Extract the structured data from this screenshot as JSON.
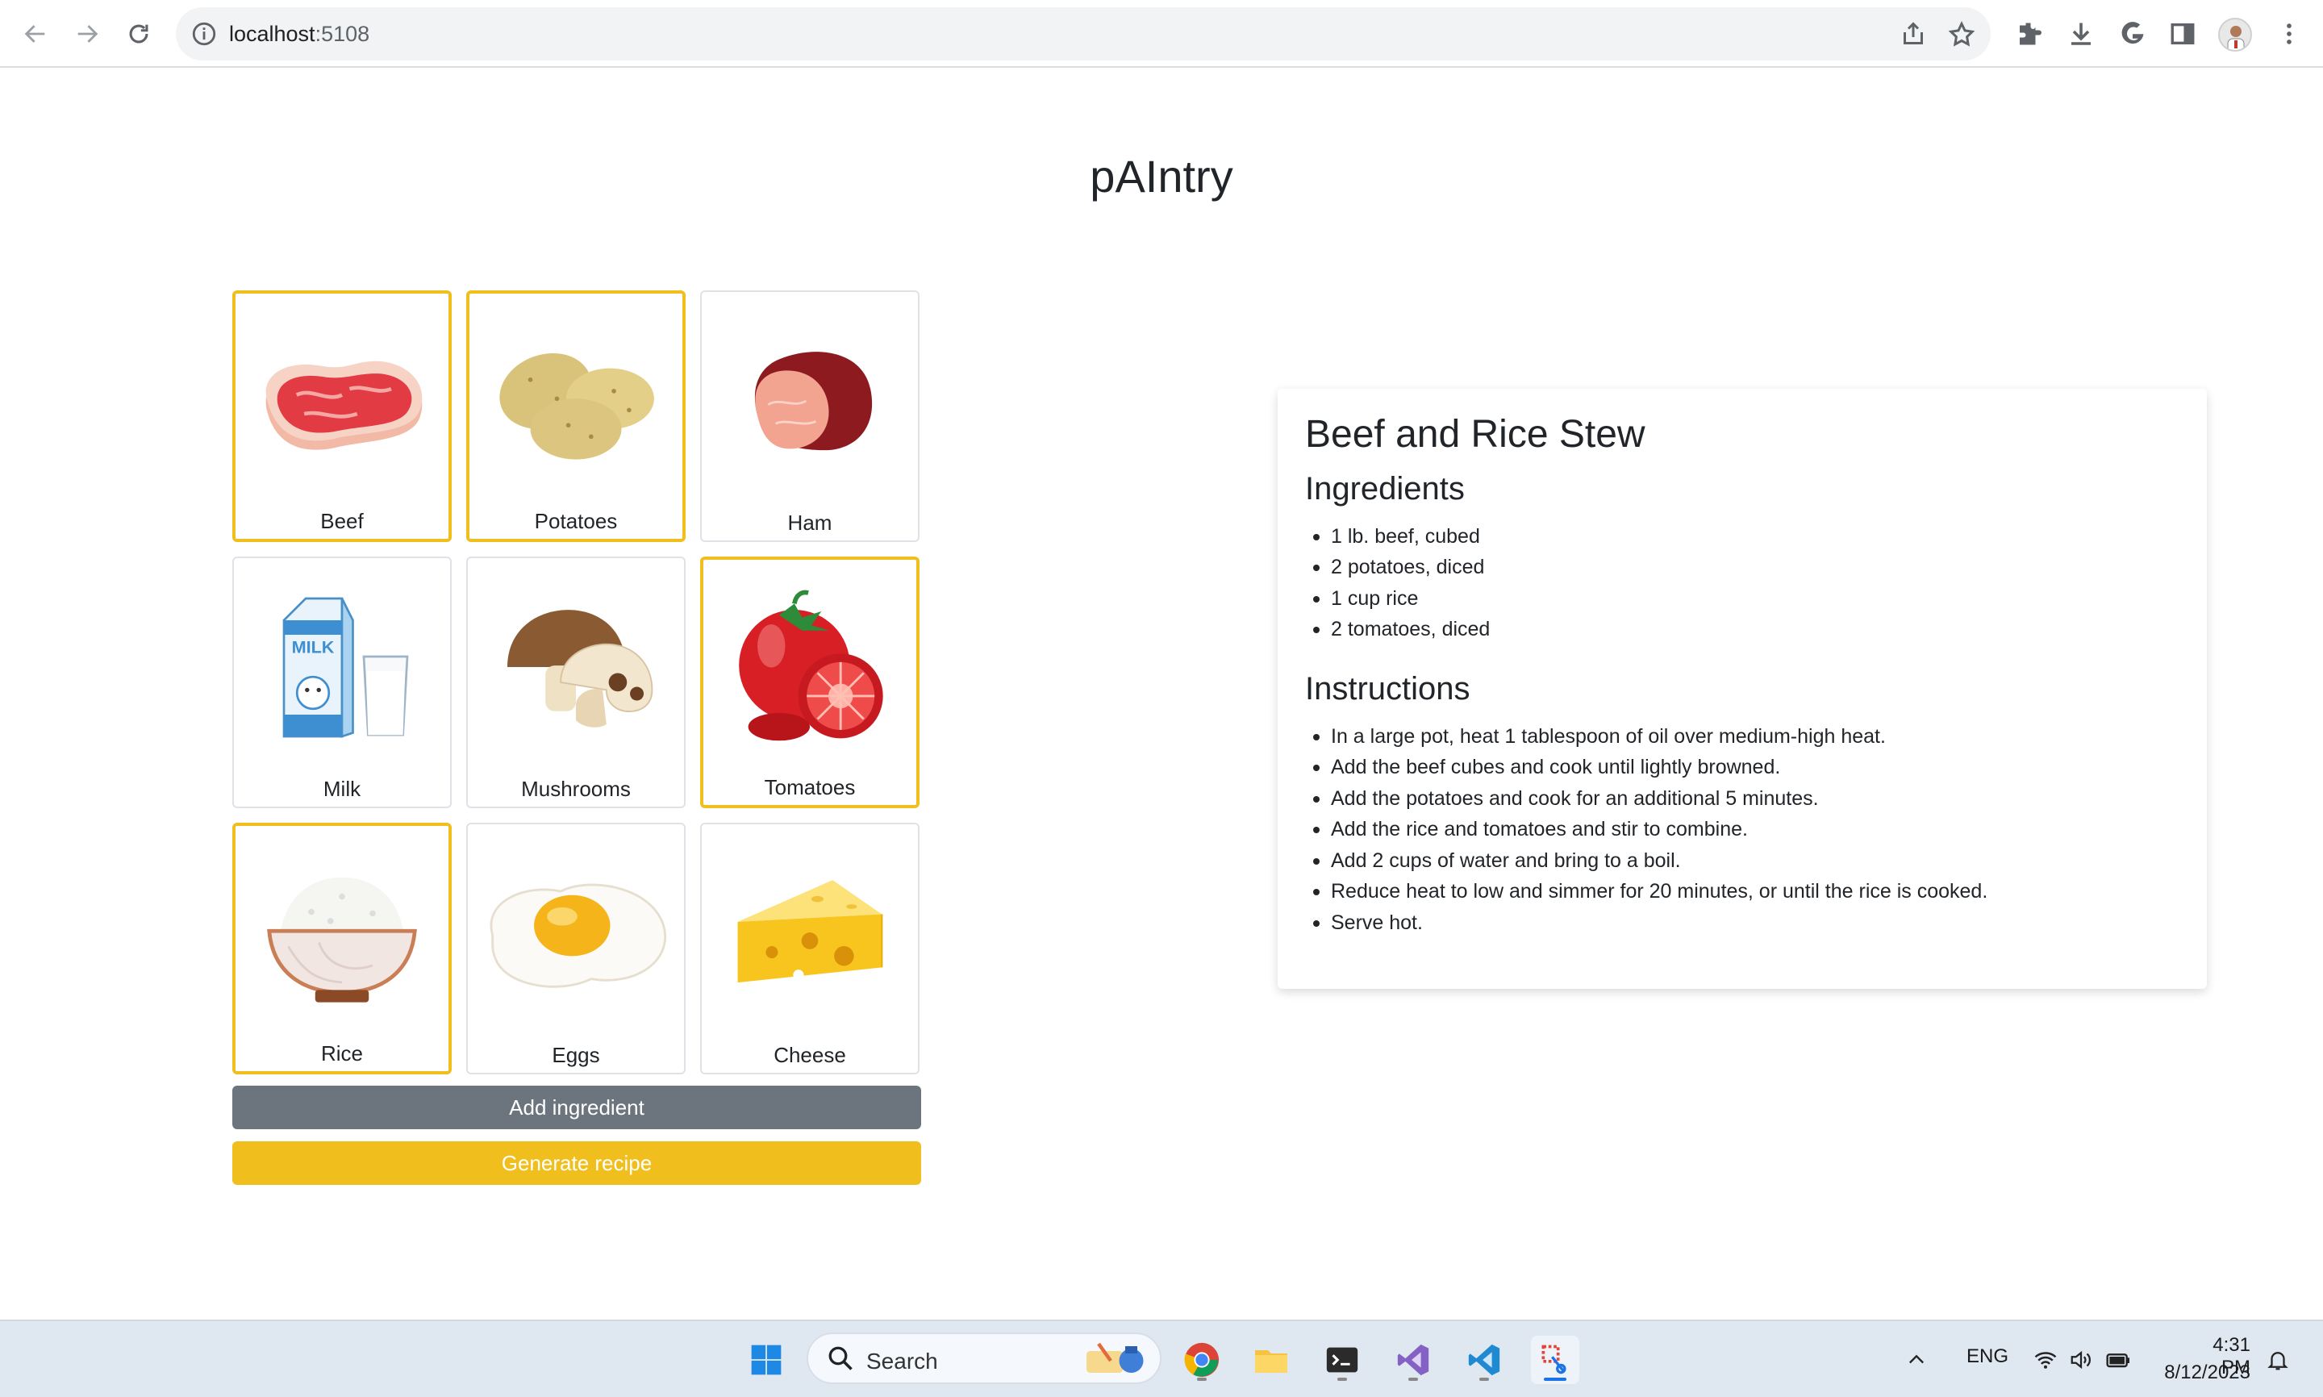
{
  "browser": {
    "url_host": "localhost",
    "url_port": ":5108"
  },
  "page": {
    "title": "pAIntry"
  },
  "ingredients": [
    {
      "name": "Beef",
      "icon": "beef-steak-icon",
      "selected": true
    },
    {
      "name": "Potatoes",
      "icon": "potatoes-icon",
      "selected": true
    },
    {
      "name": "Ham",
      "icon": "ham-icon",
      "selected": false
    },
    {
      "name": "Milk",
      "icon": "milk-carton-icon",
      "selected": false
    },
    {
      "name": "Mushrooms",
      "icon": "mushrooms-icon",
      "selected": false
    },
    {
      "name": "Tomatoes",
      "icon": "tomatoes-icon",
      "selected": true
    },
    {
      "name": "Rice",
      "icon": "rice-bowl-icon",
      "selected": true
    },
    {
      "name": "Eggs",
      "icon": "fried-egg-icon",
      "selected": false
    },
    {
      "name": "Cheese",
      "icon": "cheese-icon",
      "selected": false
    }
  ],
  "buttons": {
    "add_label": "Add ingredient",
    "generate_label": "Generate recipe"
  },
  "recipe": {
    "title": "Beef and Rice Stew",
    "ingredients_heading": "Ingredients",
    "ingredients": [
      "1 lb. beef, cubed",
      "2 potatoes, diced",
      "1 cup rice",
      "2 tomatoes, diced"
    ],
    "instructions_heading": "Instructions",
    "instructions": [
      "In a large pot, heat 1 tablespoon of oil over medium-high heat.",
      "Add the beef cubes and cook until lightly browned.",
      "Add the potatoes and cook for an additional 5 minutes.",
      "Add the rice and tomatoes and stir to combine.",
      "Add 2 cups of water and bring to a boil.",
      "Reduce heat to low and simmer for 20 minutes, or until the rice is cooked.",
      "Serve hot."
    ]
  },
  "taskbar": {
    "search_label": "Search",
    "language": "ENG",
    "time": "4:31 PM",
    "date": "8/12/2023"
  },
  "colors": {
    "selected_border": "#f0bf1e",
    "add_button": "#6c757d",
    "generate_button": "#f0bf1e"
  }
}
